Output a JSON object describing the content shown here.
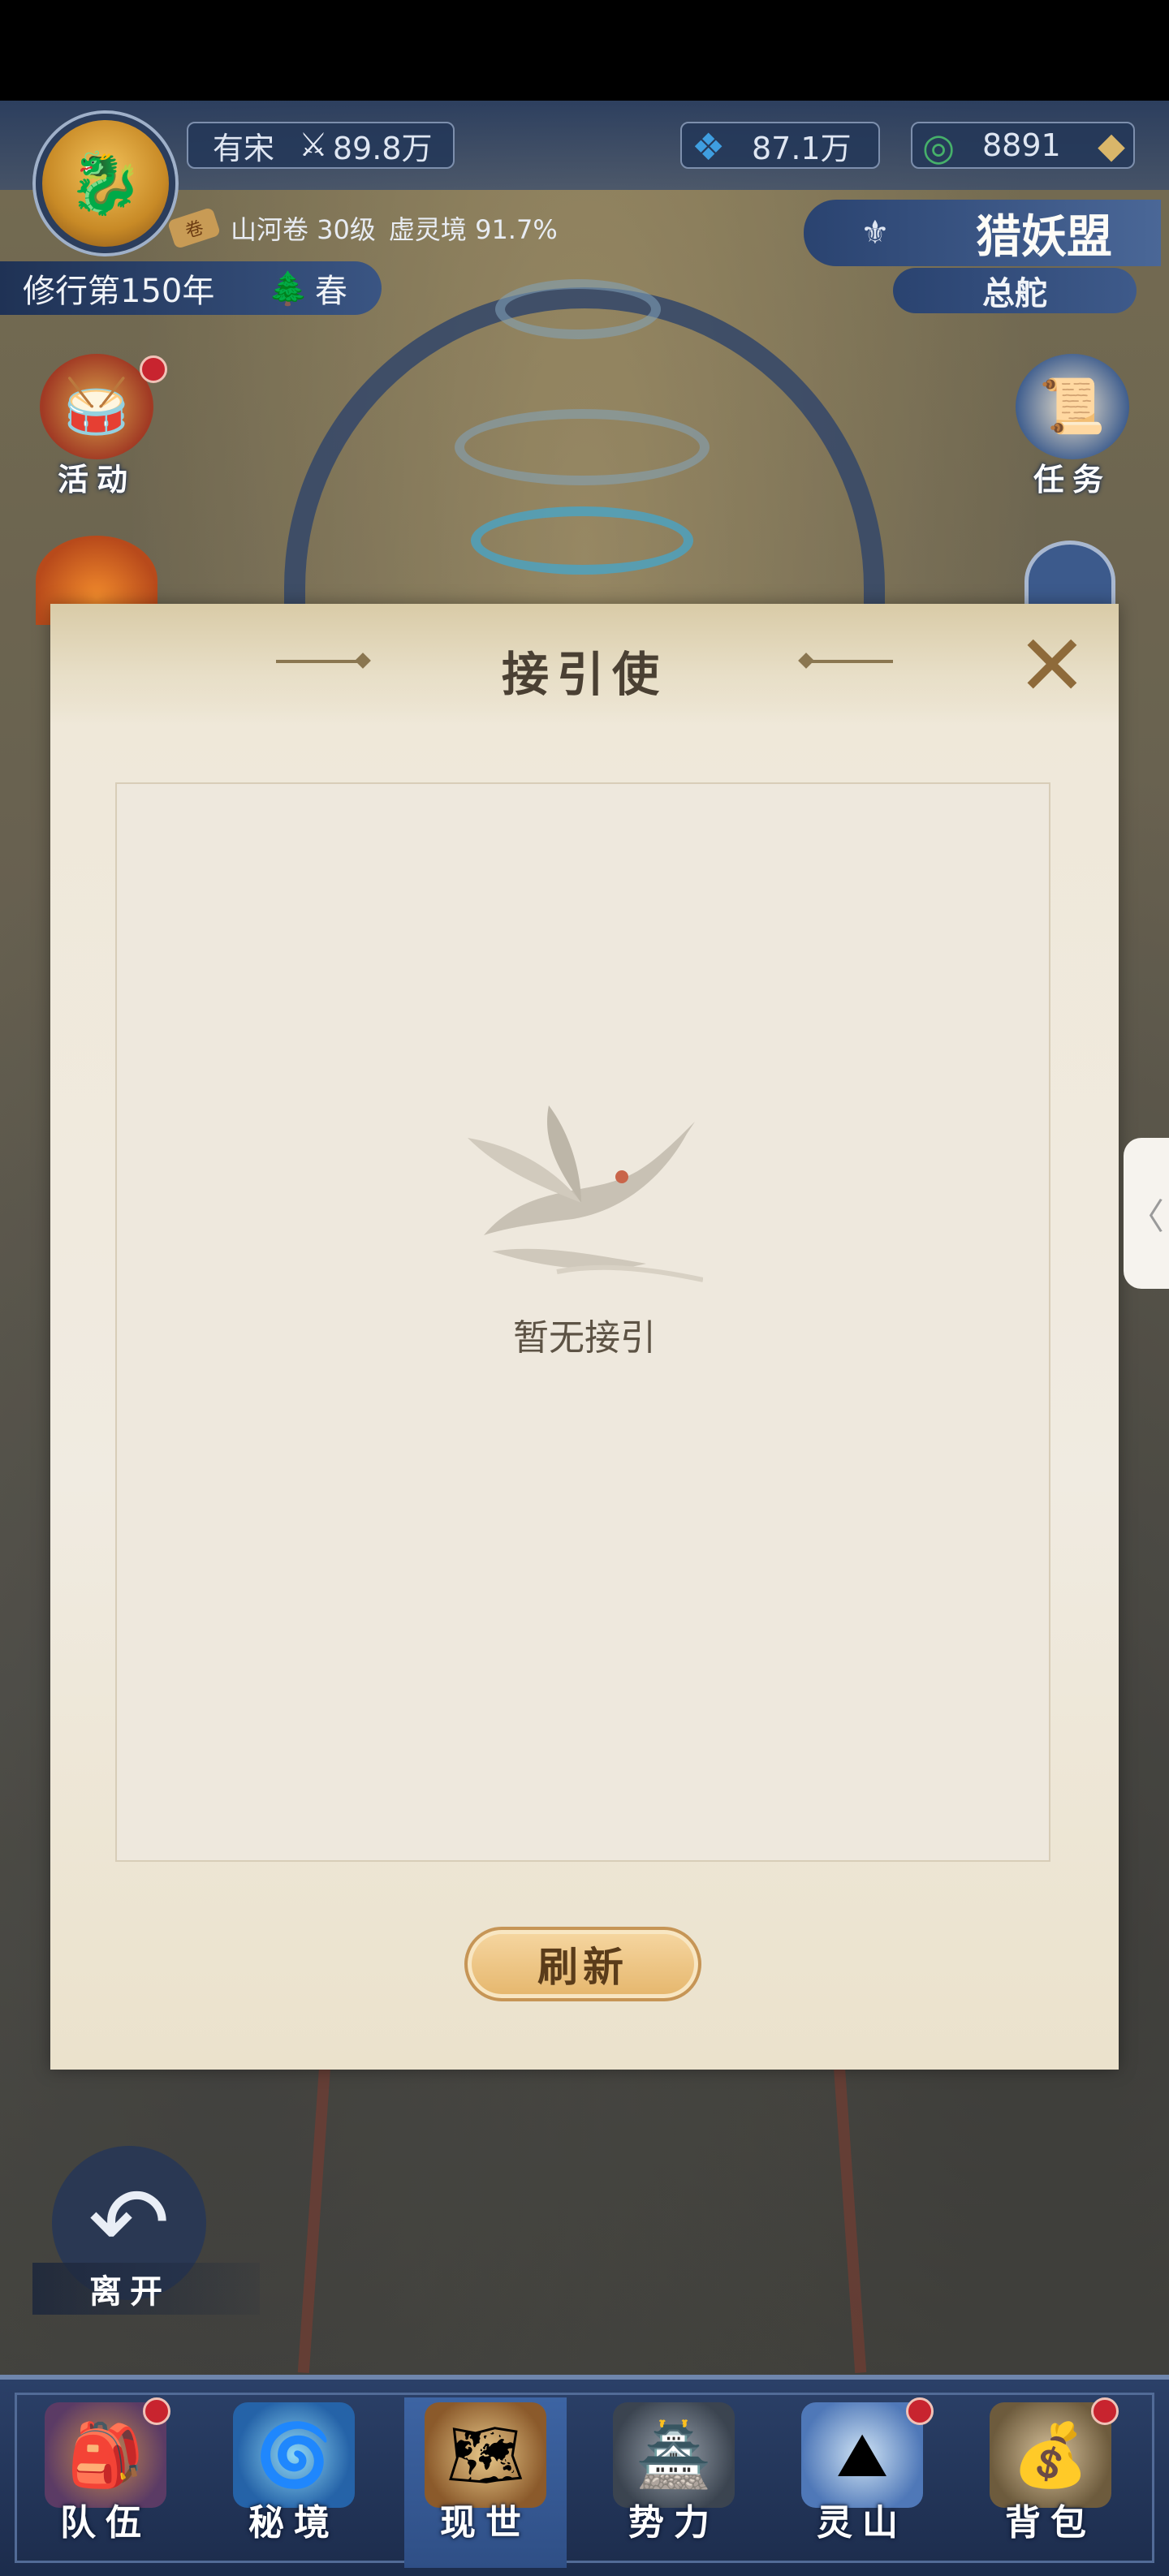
{
  "player": {
    "name": "有宋",
    "power": "89.8万",
    "resource1": "87.1万",
    "resource2": "8891",
    "scroll_level": "山河卷 30级",
    "realm": "虚灵境 91.7%",
    "year": "修行第150年",
    "season": "春"
  },
  "league": {
    "title": "猎妖盟",
    "subtitle": "总舵"
  },
  "side_buttons": {
    "activity": "活动",
    "task": "任务"
  },
  "modal": {
    "title": "接引使",
    "empty_text": "暂无接引",
    "refresh_label": "刷新"
  },
  "leave_label": "离开",
  "nav": {
    "items": [
      {
        "label": "队伍",
        "icon": "team-icon"
      },
      {
        "label": "秘境",
        "icon": "secret-realm-icon"
      },
      {
        "label": "现世",
        "icon": "world-icon"
      },
      {
        "label": "势力",
        "icon": "faction-icon"
      },
      {
        "label": "灵山",
        "icon": "spirit-mountain-icon"
      },
      {
        "label": "背包",
        "icon": "backpack-icon"
      }
    ],
    "active": "现世"
  },
  "colors": {
    "hud_blue": "#2a4370",
    "modal_bg": "#f0ebe1",
    "refresh_gold": "#e5b66c",
    "badge_red": "#c8242f"
  }
}
